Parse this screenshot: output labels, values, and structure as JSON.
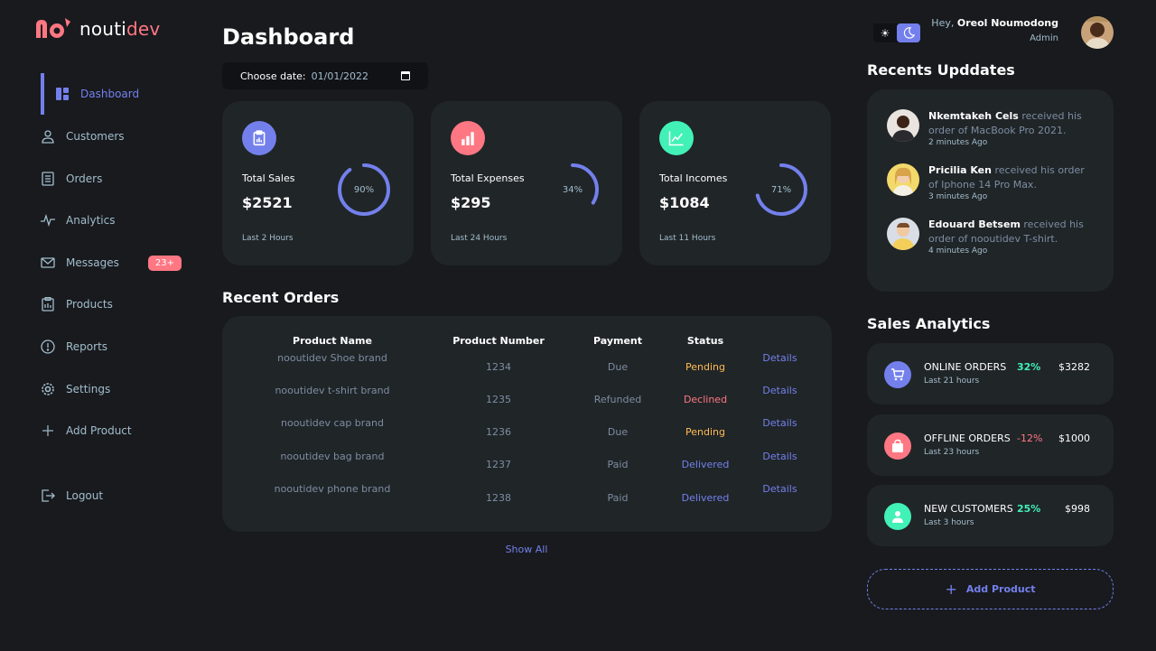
{
  "brand": {
    "prefix": "nouti",
    "suffix": "dev"
  },
  "sidebar": {
    "items": [
      {
        "label": "Dashboard",
        "icon": "grid-icon",
        "active": true
      },
      {
        "label": "Customers",
        "icon": "person-icon"
      },
      {
        "label": "Orders",
        "icon": "receipt-icon"
      },
      {
        "label": "Analytics",
        "icon": "pulse-icon"
      },
      {
        "label": "Messages",
        "icon": "mail-icon",
        "badge": "23+"
      },
      {
        "label": "Products",
        "icon": "clipboard-icon"
      },
      {
        "label": "Reports",
        "icon": "alert-circle-icon"
      },
      {
        "label": "Settings",
        "icon": "gear-icon"
      },
      {
        "label": "Add Product",
        "icon": "plus-icon"
      },
      {
        "label": "Logout",
        "icon": "logout-icon"
      }
    ]
  },
  "header": {
    "title": "Dashboard",
    "date_label": "Choose date:",
    "date_value": "01/01/2022"
  },
  "cards": [
    {
      "label": "Total Sales",
      "amount": "$2521",
      "percent_text": "90%",
      "percent": 90,
      "sub": "Last 2 Hours",
      "color": "#7380ec"
    },
    {
      "label": "Total Expenses",
      "amount": "$295",
      "percent_text": "34%",
      "percent": 34,
      "sub": "Last 24 Hours",
      "color": "#ff7782"
    },
    {
      "label": "Total Incomes",
      "amount": "$1084",
      "percent_text": "71%",
      "percent": 71,
      "sub": "Last 11 Hours",
      "color": "#41f1b6"
    }
  ],
  "recent_orders": {
    "title": "Recent Orders",
    "headers": [
      "Product Name",
      "Product Number",
      "Payment",
      "Status"
    ],
    "rows": [
      {
        "name": "nooutidev Shoe brand",
        "number": "1234",
        "payment": "Due",
        "status": "Pending",
        "link": "Details"
      },
      {
        "name": "nooutidev t-shirt brand",
        "number": "1235",
        "payment": "Refunded",
        "status": "Declined",
        "link": "Details"
      },
      {
        "name": "nooutidev cap brand",
        "number": "1236",
        "payment": "Due",
        "status": "Pending",
        "link": "Details"
      },
      {
        "name": "nooutidev bag brand",
        "number": "1237",
        "payment": "Paid",
        "status": "Delivered",
        "link": "Details"
      },
      {
        "name": "nooutidev phone brand",
        "number": "1238",
        "payment": "Paid",
        "status": "Delivered",
        "link": "Details"
      }
    ],
    "show_all": "Show All"
  },
  "profile": {
    "greeting": "Hey,",
    "name": "Oreol Noumodong",
    "role": "Admin"
  },
  "recent_updates": {
    "title": "Recents Upddates",
    "items": [
      {
        "name": "Nkemtakeh Cels",
        "text": "received his order of MacBook Pro 2021.",
        "time": "2 minutes Ago"
      },
      {
        "name": "Pricilia Ken",
        "text": "received his order of Iphone 14 Pro Max.",
        "time": "3 minutes Ago"
      },
      {
        "name": "Edouard Betsem",
        "text": "received his order of nooutidev T-shirt.",
        "time": "4 minutes Ago"
      }
    ]
  },
  "sales_analytics": {
    "title": "Sales Analytics",
    "items": [
      {
        "name": "ONLINE ORDERS",
        "sub": "Last 21 hours",
        "percent": "32%",
        "value": "$3282",
        "color": "#7380ec",
        "pct_color": "#41f1b6",
        "icon": "cart-icon"
      },
      {
        "name": "OFFLINE ORDERS",
        "sub": "Last 23 hours",
        "percent": "-12%",
        "value": "$1000",
        "color": "#ff7782",
        "pct_color": "#ff7782",
        "icon": "bag-icon"
      },
      {
        "name": "NEW CUSTOMERS",
        "sub": "Last 3 hours",
        "percent": "25%",
        "value": "$998",
        "color": "#41f1b6",
        "pct_color": "#41f1b6",
        "icon": "person-icon"
      }
    ],
    "add_button": "Add Product"
  },
  "colors": {
    "primary": "#7380ec",
    "danger": "#ff7782",
    "success": "#41f1b6",
    "warning": "#ffbb55",
    "background": "#181a1e",
    "panel": "#202528"
  }
}
